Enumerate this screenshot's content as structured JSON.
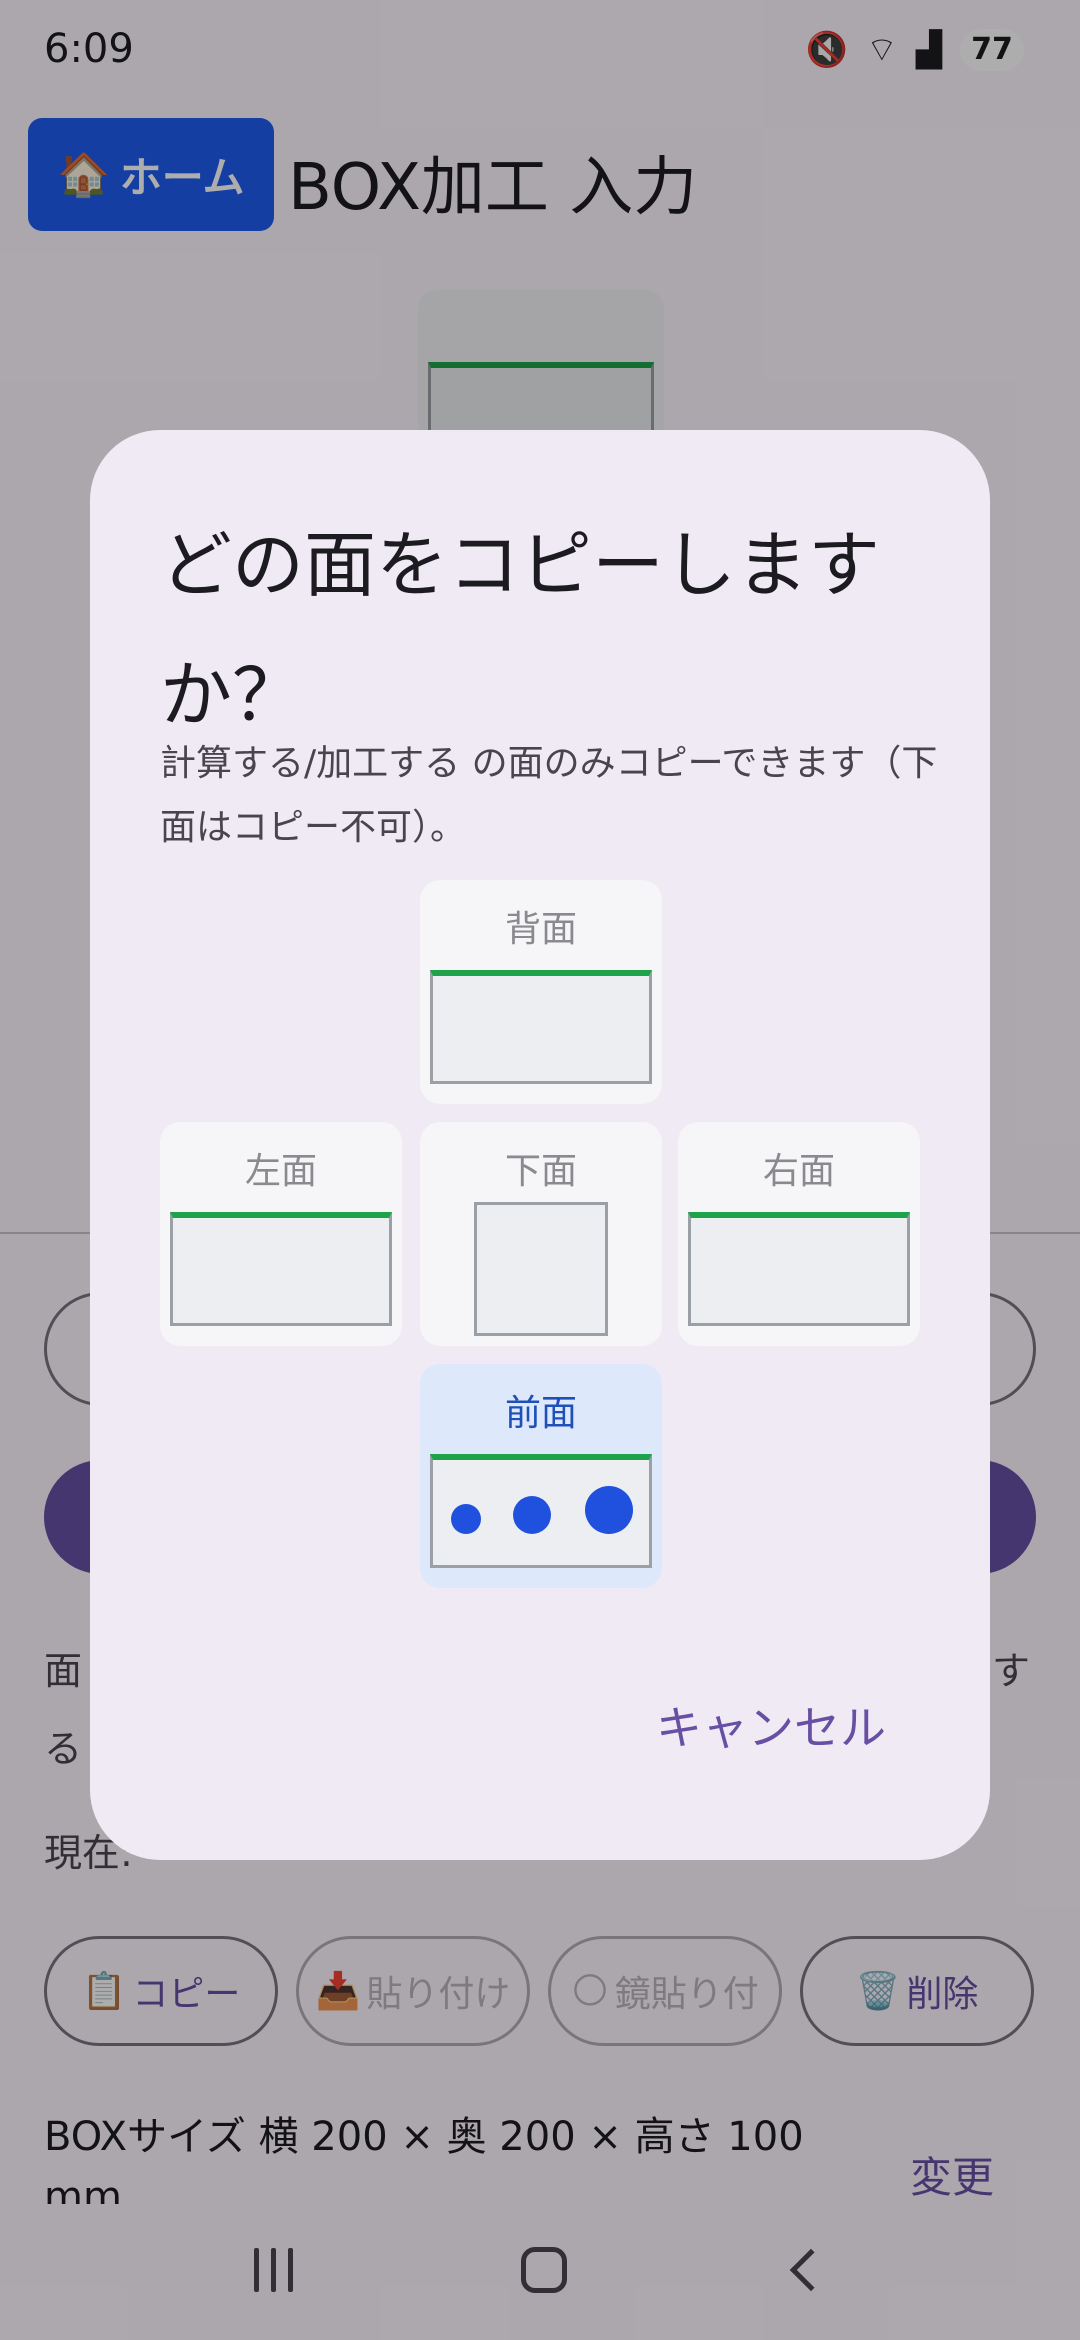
{
  "status_bar": {
    "time": "6:09",
    "battery": "77",
    "icons": [
      "mute-icon",
      "wifi-icon",
      "signal-icon"
    ]
  },
  "header": {
    "home_icon": "🏠",
    "home_label": "ホーム",
    "title": "BOX加工 入力"
  },
  "background": {
    "text_line1_start": "面",
    "text_line1_end": "す",
    "text_line2_start": "る",
    "current_label": "現在:",
    "chips": [
      {
        "icon": "📋",
        "label": "コピー",
        "enabled": true
      },
      {
        "icon": "📥",
        "label": "貼り付け",
        "enabled": false
      },
      {
        "icon": "🌕",
        "label": "鏡貼り付",
        "enabled": false
      },
      {
        "icon": "🗑️",
        "label": "削除",
        "enabled": true
      }
    ],
    "box_size": "BOXサイズ  横 200 × 奥 200 × 高さ 100",
    "box_size_unit": "mm",
    "change_label": "変更"
  },
  "dialog": {
    "title": "どの面をコピーしますか？",
    "description": "計算する/加工する の面のみコピーできます（下面はコピー不可）。",
    "faces": {
      "back": "背面",
      "left": "左面",
      "bottom": "下面",
      "right": "右面",
      "front": "前面"
    },
    "selected_face": "front",
    "cancel_label": "キャンセル"
  },
  "colors": {
    "accent": "#6750a4",
    "home_button": "#1f5cf0",
    "face_top_edge": "#1ea34a",
    "hole_dot": "#1f50de",
    "selected_face_bg": "#dde8fb"
  }
}
